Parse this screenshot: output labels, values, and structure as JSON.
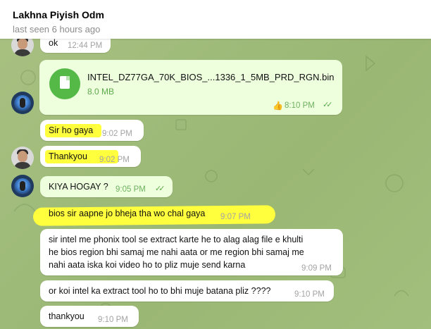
{
  "header": {
    "contact_name": "Lakhna Piyish Odm",
    "last_seen": "last seen 6 hours ago"
  },
  "messages": [
    {
      "text": "ok",
      "time": "12:44 PM"
    },
    {
      "file_name": "INTEL_DZ77GA_70K_BIOS_...1336_1_5MB_PRD_RGN.bin",
      "file_size": "8.0 MB",
      "reaction": "👍",
      "time": "8:10 PM",
      "status": "read"
    },
    {
      "text": "Sir ho gaya",
      "time": "9:02 PM"
    },
    {
      "text": "Thankyou",
      "time": "9:02 PM"
    },
    {
      "text": "KIYA HOGAY ?",
      "time": "9:05 PM",
      "status": "read"
    },
    {
      "text": "bios sir aapne jo bheja tha wo chal gaya",
      "time": "9:07 PM"
    },
    {
      "lines": [
        "sir intel me phonix tool se extract karte he to alag alag file e khulti",
        "he bios region bhi samaj me nahi aata or me region bhi samaj me",
        "nahi aata iska koi video ho to pliz muje send karna"
      ],
      "time": "9:09 PM"
    },
    {
      "text": "or koi intel ka extract tool ho to bhi muje batana pliz ????",
      "time": "9:10 PM"
    },
    {
      "text": "thankyou",
      "time": "9:10 PM"
    }
  ],
  "colors": {
    "background": "#a3bf7d",
    "outgoing_bubble": "#eeffde",
    "incoming_bubble": "#ffffff",
    "highlight": "#ffff3d",
    "accent": "#55b948"
  },
  "icons": {
    "file": "document-icon",
    "read": "double-check-icon",
    "reaction": "thumbs-up-icon"
  }
}
